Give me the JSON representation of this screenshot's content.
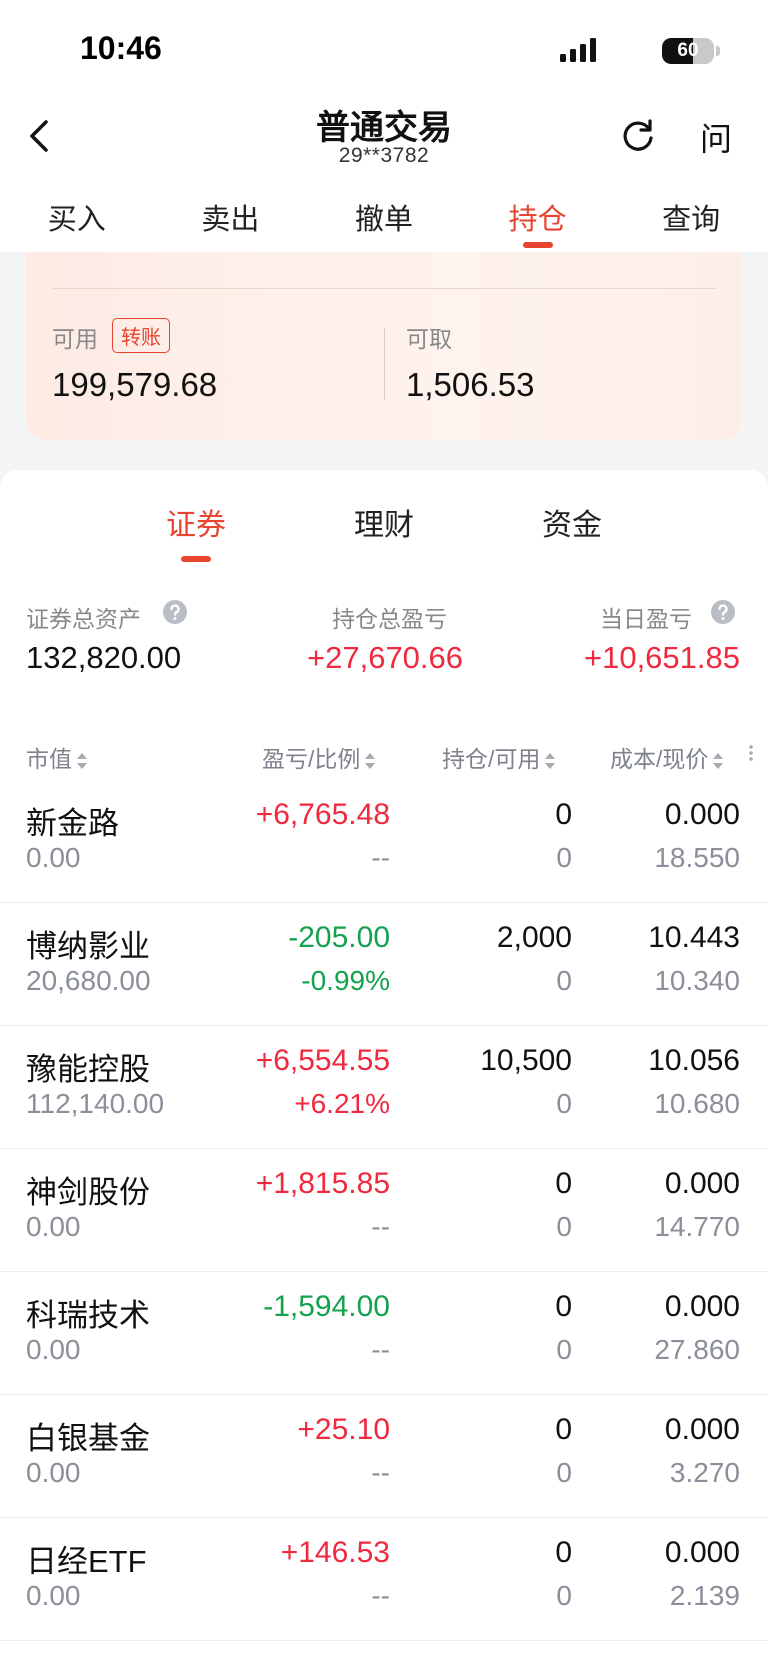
{
  "status": {
    "time": "10:46",
    "battery": "60",
    "battery_level": 0.6
  },
  "nav": {
    "title": "普通交易",
    "account": "29**3782",
    "help_label": "问"
  },
  "top_tabs": [
    {
      "label": "买入"
    },
    {
      "label": "卖出"
    },
    {
      "label": "撤单"
    },
    {
      "label": "持仓",
      "active": true
    },
    {
      "label": "查询"
    }
  ],
  "funds": {
    "available_label": "可用",
    "transfer_label": "转账",
    "available_value": "199,579.68",
    "withdrawable_label": "可取",
    "withdrawable_value": "1,506.53"
  },
  "sub_tabs": [
    {
      "label": "证券",
      "active": true
    },
    {
      "label": "理财"
    },
    {
      "label": "资金"
    }
  ],
  "summary": {
    "total_assets_label": "证券总资产",
    "total_assets_value": "132,820.00",
    "position_pl_label": "持仓总盈亏",
    "position_pl_value": "+27,670.66",
    "daily_pl_label": "当日盈亏",
    "daily_pl_value": "+10,651.85"
  },
  "columns": {
    "market_value": "市值",
    "pl_ratio": "盈亏/比例",
    "position_available": "持仓/可用",
    "cost_price": "成本/现价"
  },
  "holdings": [
    {
      "name": "新金路",
      "market_value": "0.00",
      "pl": "+6,765.48",
      "pl_pct": "--",
      "qty": "0",
      "avail": "0",
      "cost": "0.000",
      "price": "18.550",
      "trend": "up"
    },
    {
      "name": "博纳影业",
      "market_value": "20,680.00",
      "pl": "-205.00",
      "pl_pct": "-0.99%",
      "qty": "2,000",
      "avail": "0",
      "cost": "10.443",
      "price": "10.340",
      "trend": "down"
    },
    {
      "name": "豫能控股",
      "market_value": "112,140.00",
      "pl": "+6,554.55",
      "pl_pct": "+6.21%",
      "qty": "10,500",
      "avail": "0",
      "cost": "10.056",
      "price": "10.680",
      "trend": "up"
    },
    {
      "name": "神剑股份",
      "market_value": "0.00",
      "pl": "+1,815.85",
      "pl_pct": "--",
      "qty": "0",
      "avail": "0",
      "cost": "0.000",
      "price": "14.770",
      "trend": "up"
    },
    {
      "name": "科瑞技术",
      "market_value": "0.00",
      "pl": "-1,594.00",
      "pl_pct": "--",
      "qty": "0",
      "avail": "0",
      "cost": "0.000",
      "price": "27.860",
      "trend": "down"
    },
    {
      "name": "白银基金",
      "market_value": "0.00",
      "pl": "+25.10",
      "pl_pct": "--",
      "qty": "0",
      "avail": "0",
      "cost": "0.000",
      "price": "3.270",
      "trend": "up"
    },
    {
      "name": "日经ETF",
      "market_value": "0.00",
      "pl": "+146.53",
      "pl_pct": "--",
      "qty": "0",
      "avail": "0",
      "cost": "0.000",
      "price": "2.139",
      "trend": "up"
    }
  ],
  "colors": {
    "accent": "#e8442f",
    "gain": "#f0293f",
    "loss": "#14a24f",
    "muted": "#8a8f99"
  }
}
